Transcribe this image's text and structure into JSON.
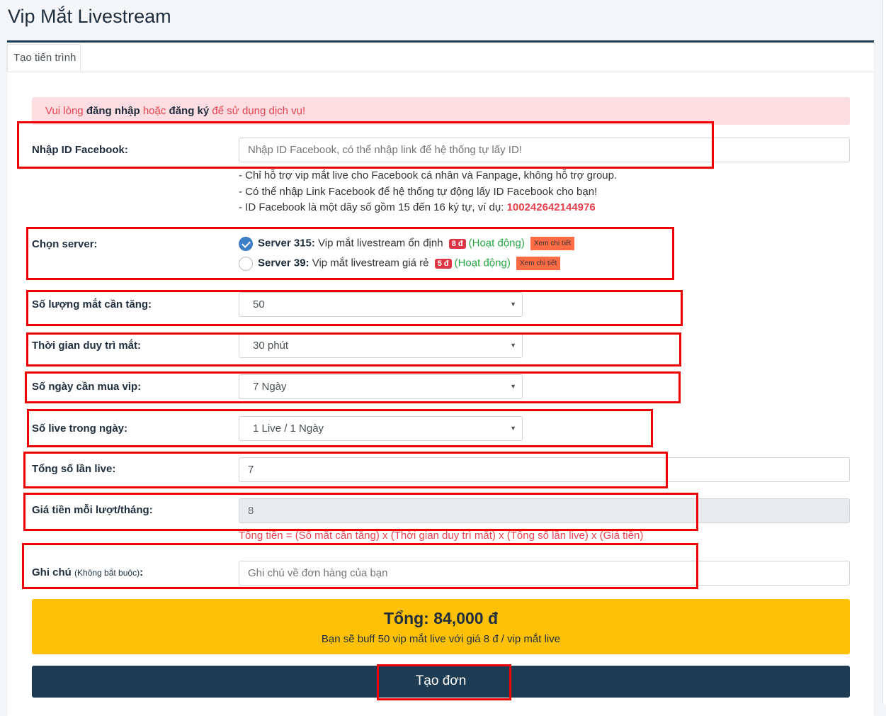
{
  "page_title": "Vip Mắt Livestream",
  "tab_label": "Tạo tiến trình",
  "alert": {
    "part1": "Vui lòng ",
    "login": "đăng nhập",
    "part2": " hoặc ",
    "register": "đăng ký",
    "part3": " để sử dụng dịch vụ!"
  },
  "facebook_id": {
    "label": "Nhập ID Facebook:",
    "placeholder": "Nhập ID Facebook, có thể nhập link để hệ thống tự lấy ID!",
    "notes": [
      "- Chỉ hỗ trợ vip mắt live cho Facebook cá nhân và Fanpage, không hỗ trợ group.",
      "- Có thể nhập Link Facebook để hệ thống tự động lấy ID Facebook cho bạn!"
    ],
    "note3_prefix": "- ID Facebook là một dãy số gồm 15 đến 16 ký tự, ví dụ: ",
    "note3_example": "100242642144976"
  },
  "server": {
    "label": "Chọn server:",
    "options": [
      {
        "name": "Server 315:",
        "desc": " Vip mắt livestream ổn định",
        "price": "8 đ",
        "status": "(Hoạt động)",
        "detail": "Xem chi tiết",
        "checked": true
      },
      {
        "name": "Server 39:",
        "desc": " Vip mắt livestream giá rẻ",
        "price": "5 đ",
        "status": "(Hoạt động)",
        "detail": "Xem chi tiết",
        "checked": false
      }
    ]
  },
  "quantity": {
    "label": "Số lượng mắt cần tăng:",
    "value": "50"
  },
  "duration": {
    "label": "Thời gian duy trì mắt:",
    "value": "30 phút"
  },
  "vip_days": {
    "label": "Số ngày cần mua vip:",
    "value": "7 Ngày"
  },
  "live_per_day": {
    "label": "Số live trong ngày:",
    "value": "1 Live / 1 Ngày"
  },
  "total_lives": {
    "label": "Tổng số lần live:",
    "value": "7"
  },
  "price_per": {
    "label": "Giá tiền mỗi lượt/tháng:",
    "value": "8"
  },
  "formula": "Tổng tiền = (Số mắt cần tăng) x (Thời gian duy trì mắt) x (Tổng số lần live) x (Giá tiền)",
  "note": {
    "label": "Ghi chú",
    "label_small": "(Không bắt buộc)",
    "label_colon": ":",
    "placeholder": "Ghi chú về đơn hàng của bạn"
  },
  "total": {
    "title": "Tổng: 84,000 đ",
    "desc": "Bạn sẽ buff 50 vip mắt live với giá 8 đ / vip mắt live"
  },
  "submit_label": "Tạo đơn",
  "colors": {
    "primary_dark": "#1d3b53",
    "warning": "#ffc107",
    "danger": "#e6414f",
    "success": "#28a745",
    "highlight": "#ee0000"
  }
}
